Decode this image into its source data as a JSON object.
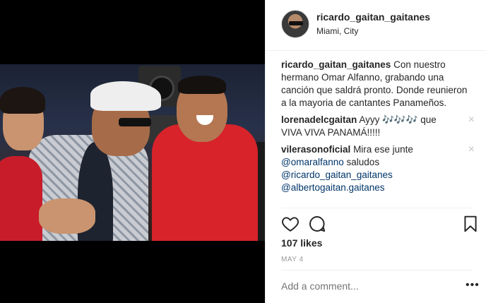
{
  "post": {
    "username": "ricardo_gaitan_gaitanes",
    "location": "Miami, City",
    "caption": {
      "user": "ricardo_gaitan_gaitanes",
      "text": "Con nuestro hermano Omar Alfanno, grabando una canción que saldrá pronto. Donde reunieron a la mayoria de cantantes Panameños."
    },
    "comments": [
      {
        "user": "lorenadelcgaitan",
        "text": "Ayyy 🎶🎶🎶 que VIVA VIVA PANAMÁ!!!!!"
      },
      {
        "user": "vilerasonoficial",
        "text": "Mira ese junte",
        "mentions": [
          "@omaralfanno",
          "@ricardo_gaitan_gaitanes",
          "@albertogaitan.gaitanes"
        ],
        "suffix": "saludos"
      }
    ],
    "likes": "107 likes",
    "date": "MAY 4",
    "add_comment_placeholder": "Add a comment...",
    "more_label": "•••",
    "close_glyph": "×"
  },
  "icons": {
    "like": "heart-icon",
    "comment": "comment-icon",
    "save": "bookmark-icon"
  }
}
